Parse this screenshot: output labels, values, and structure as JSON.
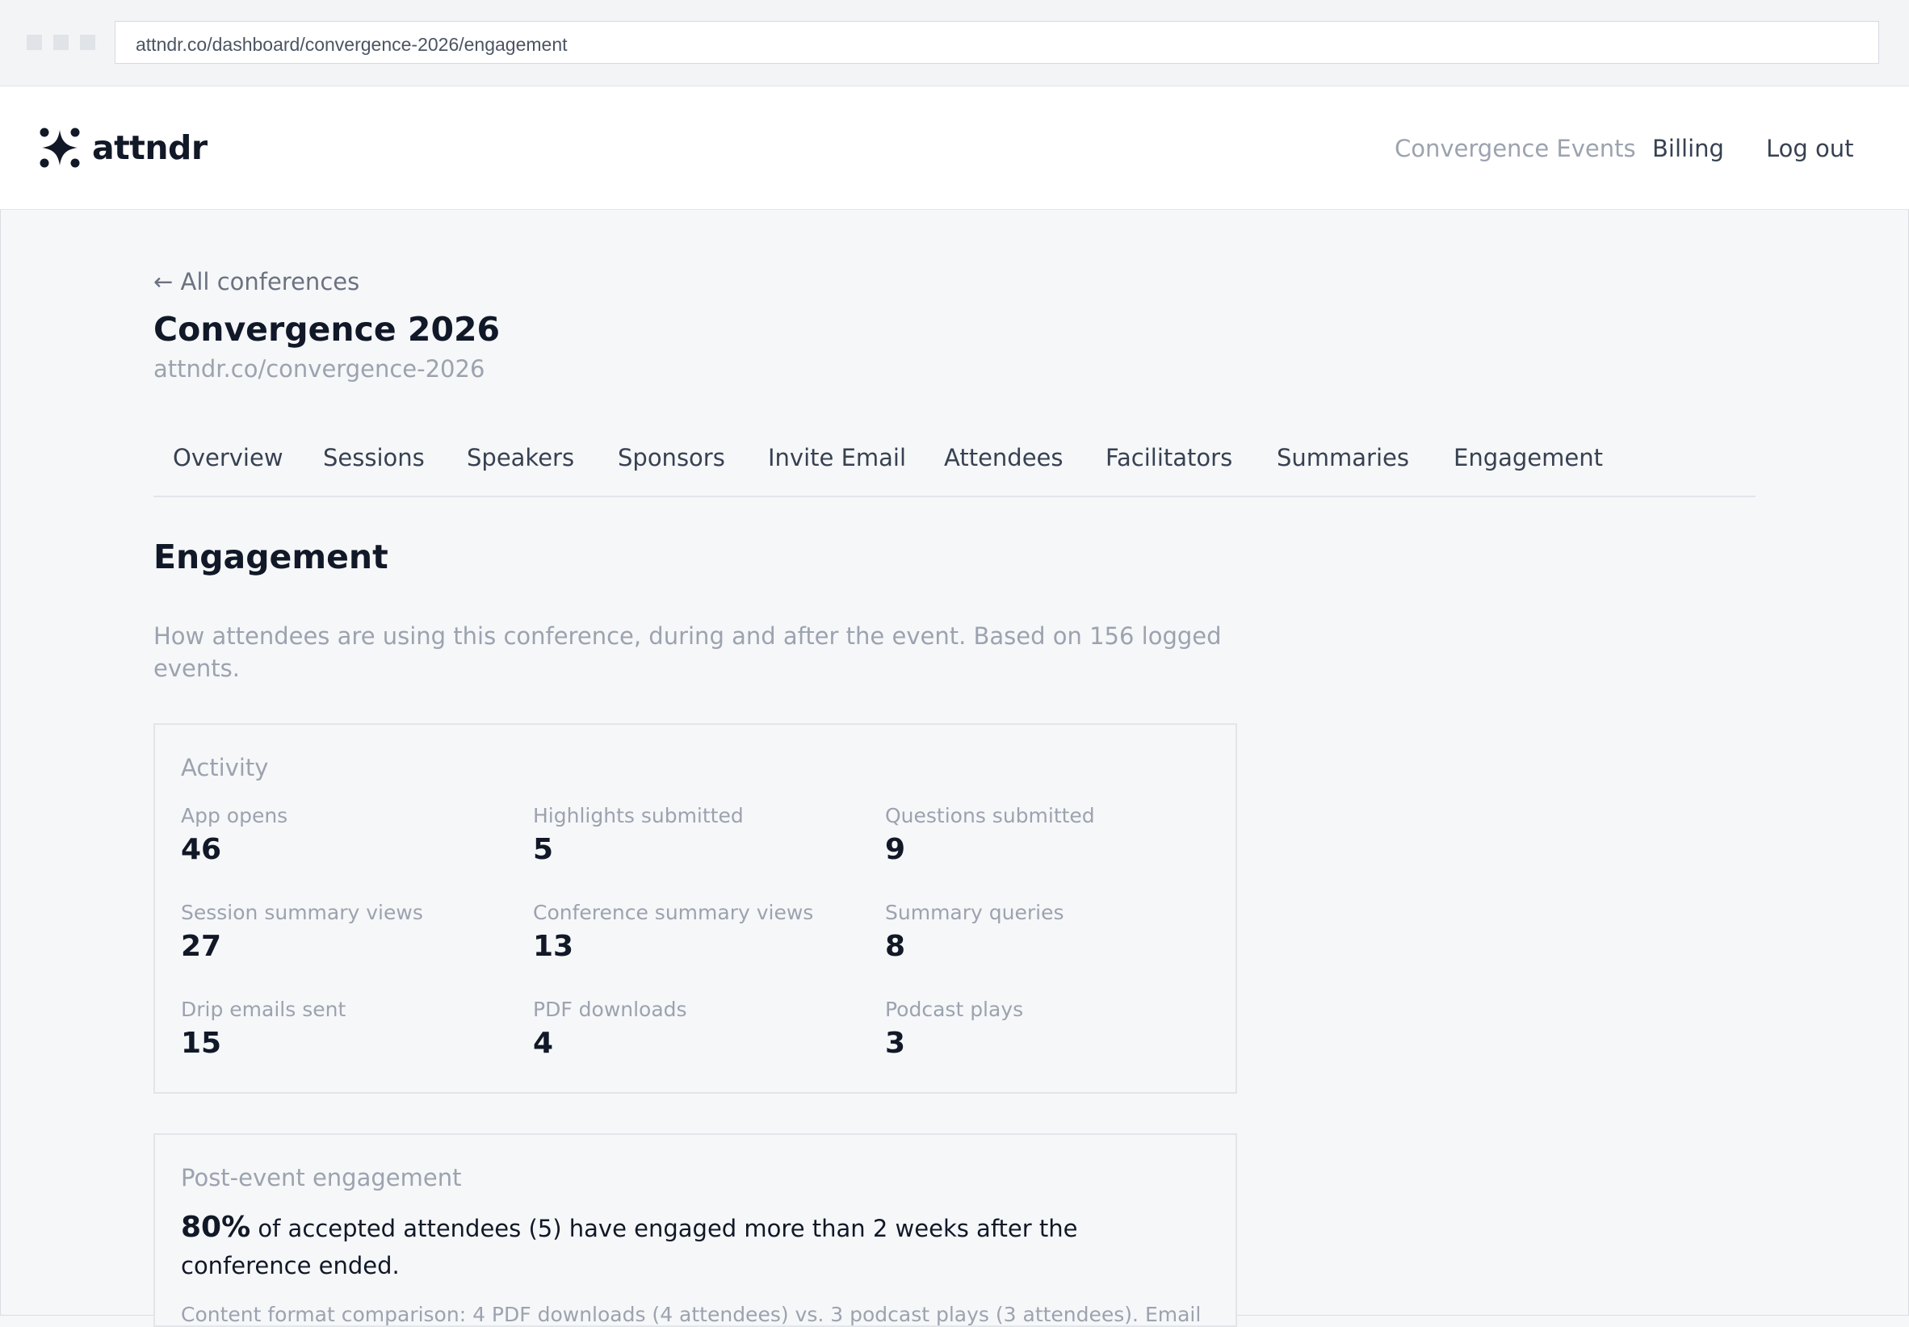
{
  "browser": {
    "url": "attndr.co/dashboard/convergence-2026/engagement"
  },
  "header": {
    "logo_text": "attndr",
    "org_name": "Convergence Events",
    "billing_label": "Billing",
    "logout_label": "Log out"
  },
  "page": {
    "back_label": "← All conferences",
    "title": "Convergence 2026",
    "slug": "attndr.co/convergence-2026"
  },
  "tabs": [
    {
      "label": "Overview"
    },
    {
      "label": "Sessions"
    },
    {
      "label": "Speakers"
    },
    {
      "label": "Sponsors"
    },
    {
      "label": "Invite Email"
    },
    {
      "label": "Attendees"
    },
    {
      "label": "Facilitators"
    },
    {
      "label": "Summaries"
    },
    {
      "label": "Engagement"
    }
  ],
  "engagement": {
    "title": "Engagement",
    "description": "How attendees are using this conference, during and after the event. Based on 156 logged events.",
    "activity": {
      "title": "Activity",
      "metrics": [
        {
          "label": "App opens",
          "value": "46"
        },
        {
          "label": "Highlights submitted",
          "value": "5"
        },
        {
          "label": "Questions submitted",
          "value": "9"
        },
        {
          "label": "Session summary views",
          "value": "27"
        },
        {
          "label": "Conference summary views",
          "value": "13"
        },
        {
          "label": "Summary queries",
          "value": "8"
        },
        {
          "label": "Drip emails sent",
          "value": "15"
        },
        {
          "label": "PDF downloads",
          "value": "4"
        },
        {
          "label": "Podcast plays",
          "value": "3"
        }
      ]
    },
    "post_event": {
      "title": "Post-event engagement",
      "percent": "80%",
      "text": "of accepted attendees (5) have engaged more than 2 weeks after the conference ended.",
      "note": "Content  format comparison: 4 PDF downloads (4 attendees) vs. 3 podcast plays (3 attendees). Email"
    }
  }
}
